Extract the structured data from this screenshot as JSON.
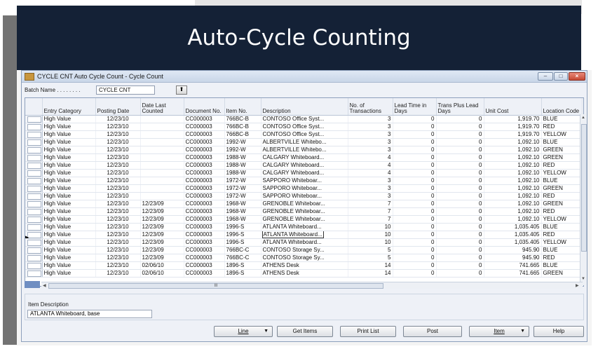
{
  "banner": {
    "title": "Auto-Cycle Counting"
  },
  "window": {
    "title": "CYCLE CNT Auto Cycle Count - Cycle Count",
    "batch_label": "Batch Name . . . . . . . .",
    "batch_value": "CYCLE CNT"
  },
  "columns": [
    "Entry Category",
    "Posting Date",
    "Date Last Counted",
    "Document No.",
    "Item No.",
    "Description",
    "No. of Transactions",
    "Lead Time in Days",
    "Trans Plus Lead Days",
    "Unit Cost",
    "Location Code"
  ],
  "rows": [
    [
      "High Value",
      "12/23/10",
      "",
      "CC000003",
      "766BC-B",
      "CONTOSO Office Syst...",
      "3",
      "0",
      "0",
      "1,919.70",
      "BLUE"
    ],
    [
      "High Value",
      "12/23/10",
      "",
      "CC000003",
      "766BC-B",
      "CONTOSO Office Syst...",
      "3",
      "0",
      "0",
      "1,919.70",
      "RED"
    ],
    [
      "High Value",
      "12/23/10",
      "",
      "CC000003",
      "766BC-B",
      "CONTOSO Office Syst...",
      "3",
      "0",
      "0",
      "1,919.70",
      "YELLOW"
    ],
    [
      "High Value",
      "12/23/10",
      "",
      "CC000003",
      "1992-W",
      "ALBERTVILLE Whitebo...",
      "3",
      "0",
      "0",
      "1,092.10",
      "BLUE"
    ],
    [
      "High Value",
      "12/23/10",
      "",
      "CC000003",
      "1992-W",
      "ALBERTVILLE Whitebo...",
      "3",
      "0",
      "0",
      "1,092.10",
      "GREEN"
    ],
    [
      "High Value",
      "12/23/10",
      "",
      "CC000003",
      "1988-W",
      "CALGARY Whiteboard...",
      "4",
      "0",
      "0",
      "1,092.10",
      "GREEN"
    ],
    [
      "High Value",
      "12/23/10",
      "",
      "CC000003",
      "1988-W",
      "CALGARY Whiteboard...",
      "4",
      "0",
      "0",
      "1,092.10",
      "RED"
    ],
    [
      "High Value",
      "12/23/10",
      "",
      "CC000003",
      "1988-W",
      "CALGARY Whiteboard...",
      "4",
      "0",
      "0",
      "1,092.10",
      "YELLOW"
    ],
    [
      "High Value",
      "12/23/10",
      "",
      "CC000003",
      "1972-W",
      "SAPPORO Whiteboar...",
      "3",
      "0",
      "0",
      "1,092.10",
      "BLUE"
    ],
    [
      "High Value",
      "12/23/10",
      "",
      "CC000003",
      "1972-W",
      "SAPPORO Whiteboar...",
      "3",
      "0",
      "0",
      "1,092.10",
      "GREEN"
    ],
    [
      "High Value",
      "12/23/10",
      "",
      "CC000003",
      "1972-W",
      "SAPPORO Whiteboar...",
      "3",
      "0",
      "0",
      "1,092.10",
      "RED"
    ],
    [
      "High Value",
      "12/23/10",
      "12/23/09",
      "CC000003",
      "1968-W",
      "GRENOBLE Whiteboar...",
      "7",
      "0",
      "0",
      "1,092.10",
      "GREEN"
    ],
    [
      "High Value",
      "12/23/10",
      "12/23/09",
      "CC000003",
      "1968-W",
      "GRENOBLE Whiteboar...",
      "7",
      "0",
      "0",
      "1,092.10",
      "RED"
    ],
    [
      "High Value",
      "12/23/10",
      "12/23/09",
      "CC000003",
      "1968-W",
      "GRENOBLE Whiteboar...",
      "7",
      "0",
      "0",
      "1,092.10",
      "YELLOW"
    ],
    [
      "High Value",
      "12/23/10",
      "12/23/09",
      "CC000003",
      "1996-S",
      "ATLANTA Whiteboard...",
      "10",
      "0",
      "0",
      "1,035.405",
      "BLUE"
    ],
    [
      "High Value",
      "12/23/10",
      "12/23/09",
      "CC000003",
      "1996-S",
      "ATLANTA Whiteboard...",
      "10",
      "0",
      "0",
      "1,035.405",
      "RED"
    ],
    [
      "High Value",
      "12/23/10",
      "12/23/09",
      "CC000003",
      "1996-S",
      "ATLANTA Whiteboard...",
      "10",
      "0",
      "0",
      "1,035.405",
      "YELLOW"
    ],
    [
      "High Value",
      "12/23/10",
      "12/23/09",
      "CC000003",
      "766BC-C",
      "CONTOSO Storage Sy...",
      "5",
      "0",
      "0",
      "945.90",
      "BLUE"
    ],
    [
      "High Value",
      "12/23/10",
      "12/23/09",
      "CC000003",
      "766BC-C",
      "CONTOSO Storage Sy...",
      "5",
      "0",
      "0",
      "945.90",
      "RED"
    ],
    [
      "High Value",
      "12/23/10",
      "02/06/10",
      "CC000003",
      "1896-S",
      "ATHENS Desk",
      "14",
      "0",
      "0",
      "741.665",
      "BLUE"
    ],
    [
      "High Value",
      "12/23/10",
      "02/06/10",
      "CC000003",
      "1896-S",
      "ATHENS Desk",
      "14",
      "0",
      "0",
      "741.665",
      "GREEN"
    ]
  ],
  "current_row": 15,
  "hscroll_thumb": "III",
  "item_description": {
    "label": "Item Description",
    "value": "ATLANTA Whiteboard, base"
  },
  "buttons": {
    "line": "Line",
    "get_items": "Get Items",
    "print_list": "Print List",
    "post": "Post",
    "item": "Item",
    "help": "Help"
  }
}
